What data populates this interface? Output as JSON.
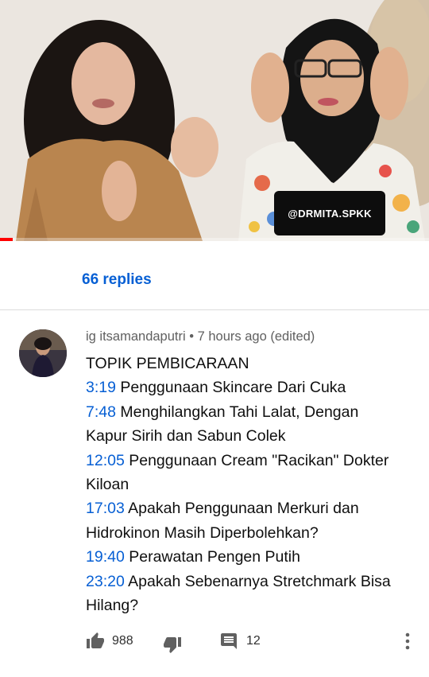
{
  "video": {
    "watermark": "@DRMITA.SPKK",
    "progress_fraction": 0.03,
    "accent_color": "#ff0000"
  },
  "replies": {
    "label": "66 replies"
  },
  "comment": {
    "author": "ig itsamandaputri",
    "separator": " • ",
    "time": "7 hours ago (edited)",
    "heading": "TOPIK PEMBICARAAN",
    "entries": [
      {
        "ts": "3:19",
        "lines": [
          "Penggunaan Skincare Dari Cuka"
        ]
      },
      {
        "ts": "7:48",
        "lines": [
          "Menghilangkan Tahi Lalat, Dengan",
          "Kapur Sirih dan Sabun Colek"
        ]
      },
      {
        "ts": "12:05",
        "lines": [
          "Penggunaan Cream \"Racikan\" Dokter",
          "Kiloan"
        ]
      },
      {
        "ts": "17:03",
        "lines": [
          "Apakah Penggunaan Merkuri dan",
          "Hidrokinon Masih Diperbolehkan?"
        ]
      },
      {
        "ts": "19:40",
        "lines": [
          "Perawatan Pengen Putih"
        ]
      },
      {
        "ts": "23:20",
        "lines": [
          "Apakah Sebenarnya Stretchmark Bisa",
          "Hilang?"
        ]
      }
    ],
    "likes": "988",
    "reply_count": "12"
  },
  "colors": {
    "link": "#065fd4",
    "meta": "#606060",
    "text": "#0f0f0f"
  },
  "icons": {
    "like": "thumb-up-icon",
    "dislike": "thumb-down-icon",
    "reply": "comment-icon",
    "more": "more-vert-icon"
  }
}
